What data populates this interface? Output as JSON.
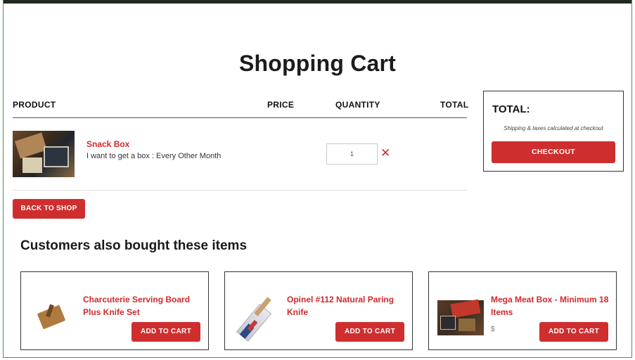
{
  "page": {
    "title": "Shopping Cart"
  },
  "cart_table": {
    "headers": {
      "product": "PRODUCT",
      "price": "PRICE",
      "quantity": "QUANTITY",
      "total": "TOTAL"
    },
    "items": [
      {
        "name": "Snack Box",
        "option": "I want to get a box : Every Other Month",
        "quantity": "1",
        "remove_icon": "close-icon",
        "image": "snack-box-photo"
      }
    ]
  },
  "actions": {
    "back_to_shop": "BACK TO SHOP"
  },
  "summary": {
    "total_label": "TOTAL:",
    "shipping_note": "Shipping & taxes calculated at checkout",
    "checkout_label": "CHECKOUT"
  },
  "upsell": {
    "title": "Customers also bought these items",
    "items": [
      {
        "name": "Charcuterie Serving Board Plus Knife Set",
        "button": "ADD TO CART",
        "image": "serving-board-photo"
      },
      {
        "name": "Opinel #112 Natural Paring Knife",
        "button": "ADD TO CART",
        "image": "paring-knife-photo"
      },
      {
        "name": "Mega Meat Box - Minimum 18 Items",
        "button": "ADD TO CART",
        "image": "meat-box-photo",
        "price_peek": "$"
      }
    ]
  },
  "colors": {
    "accent": "#cf2e2e",
    "link": "#d0282b",
    "text": "#222222",
    "frame": "#5a8a5a"
  }
}
